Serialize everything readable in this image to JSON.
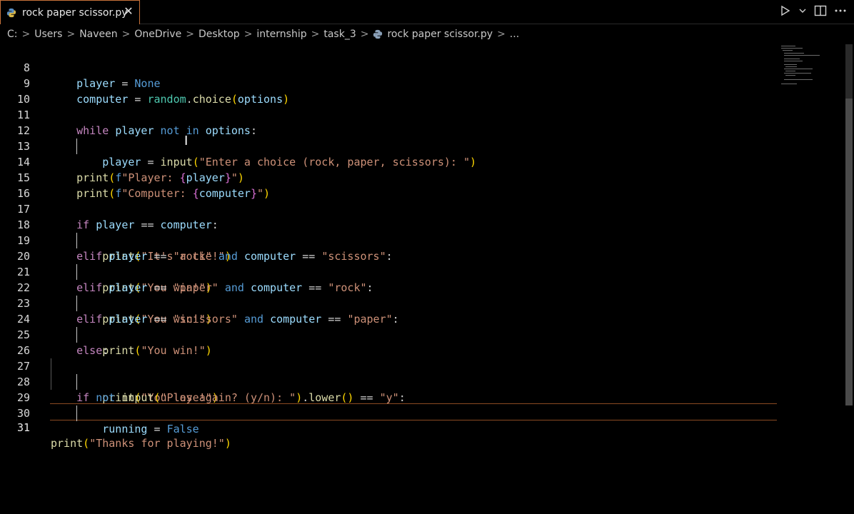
{
  "tab": {
    "label": "rock paper scissor.py",
    "close": "✕"
  },
  "breadcrumb": {
    "items": [
      "C:",
      "Users",
      "Naveen",
      "OneDrive",
      "Desktop",
      "internship",
      "task_3"
    ],
    "file": "rock paper scissor.py",
    "more": "..."
  },
  "colors": {
    "tab_border": "#c8723a",
    "keyword": "#c586c0",
    "builtin": "#569cd6",
    "function": "#dcdcaa",
    "string": "#ce9178",
    "variable": "#9cdcfe"
  },
  "editor": {
    "active_line": "31",
    "lines": [
      {
        "num": "8",
        "text": "        player = None"
      },
      {
        "num": "9",
        "text": "        computer = random.choice(options)"
      },
      {
        "num": "10",
        "text": ""
      },
      {
        "num": "11",
        "text": "        while player not in options:"
      },
      {
        "num": "12",
        "text": "            player = input(\"Enter a choice (rock, paper, scissors): \")"
      },
      {
        "num": "13",
        "text": ""
      },
      {
        "num": "14",
        "text": "        print(f\"Player: {player}\")"
      },
      {
        "num": "15",
        "text": "        print(f\"Computer: {computer}\")"
      },
      {
        "num": "16",
        "text": ""
      },
      {
        "num": "17",
        "text": "        if player == computer:"
      },
      {
        "num": "18",
        "text": "            print(\"It's a tie!\")"
      },
      {
        "num": "19",
        "text": "        elif player == \"rock\" and computer == \"scissors\":"
      },
      {
        "num": "20",
        "text": "            print(\"You win!\")"
      },
      {
        "num": "21",
        "text": "        elif player == \"paper\" and computer == \"rock\":"
      },
      {
        "num": "22",
        "text": "            print(\"You win!\")"
      },
      {
        "num": "23",
        "text": "        elif player == \"scissors\" and computer == \"paper\":"
      },
      {
        "num": "24",
        "text": "            print(\"You win!\")"
      },
      {
        "num": "25",
        "text": "        else:"
      },
      {
        "num": "26",
        "text": "            print(\"You lose!\")"
      },
      {
        "num": "27",
        "text": ""
      },
      {
        "num": "28",
        "text": "        if not input(\"Play again? (y/n): \").lower() == \"y\":"
      },
      {
        "num": "29",
        "text": "            running = False"
      },
      {
        "num": "30",
        "text": ""
      },
      {
        "num": "31",
        "text": "print(\"Thanks for playing!\")"
      }
    ]
  }
}
